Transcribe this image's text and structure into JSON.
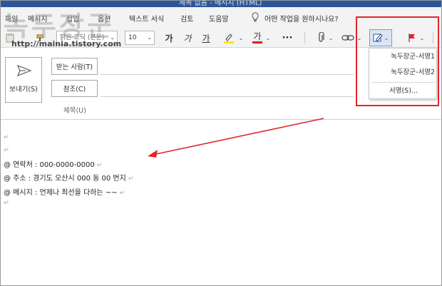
{
  "titlebar": {
    "text": "제목 없음 - 메시지 (HTML)"
  },
  "menu": {
    "items": [
      "파일",
      "메시지",
      "삽입",
      "옵션",
      "텍스트 서식",
      "검토",
      "도움말"
    ],
    "tell_me": "어떤 작업을 원하시나요?"
  },
  "ribbon": {
    "font_name": "맑은 고딕 (본문)",
    "font_size": "10",
    "bold": "가",
    "italic": "가",
    "underline": "가",
    "font_color": "가",
    "more": "···"
  },
  "signature_menu": {
    "items": [
      "녹두장군-서명1",
      "녹두장군-서명2"
    ],
    "manage": "서명(S)...",
    "manage_underline": "S"
  },
  "compose": {
    "send_label": "보내기(S)",
    "to_label": "받는 사람(T)",
    "cc_label": "참조(C)",
    "subject_label": "제목(U)"
  },
  "body": {
    "paragraph_mark": "↵",
    "lines": [
      "@ 연락처 : 000-0000-0000",
      "@ 주소 : 경기도 오산시 000 동 00 번지",
      "@ 메시지 : 언제나 최선을 다하는 ~~"
    ]
  },
  "watermark": {
    "title": "녹두장군",
    "url": "http://mainia.tistory.com"
  },
  "colors": {
    "highlight": "#e3242b",
    "ribbon_bg": "#f3f3f3",
    "title_blue": "#2b579a",
    "font_red": "#e02020",
    "highlight_yellow": "#ffe600"
  }
}
